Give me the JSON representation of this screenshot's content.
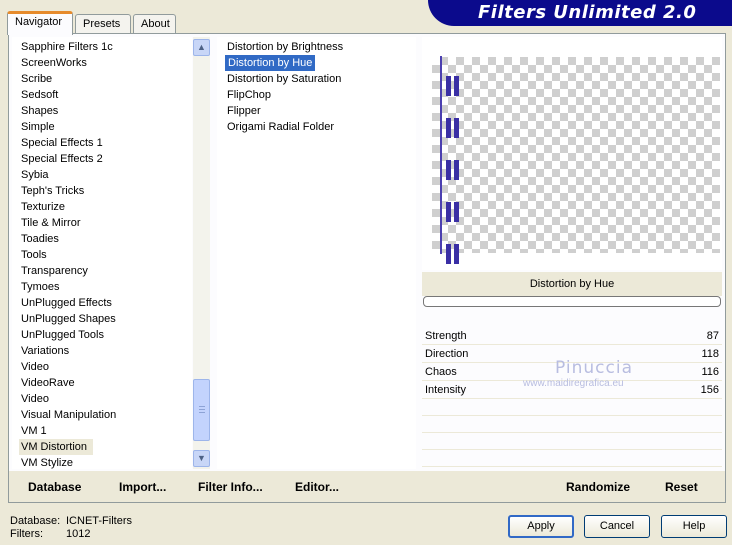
{
  "tabs": {
    "navigator": "Navigator",
    "presets": "Presets",
    "about": "About"
  },
  "banner_title": "Filters Unlimited 2.0",
  "categories": [
    "Sapphire Filters 1c",
    "ScreenWorks",
    "Scribe",
    "Sedsoft",
    "Shapes",
    "Simple",
    "Special Effects 1",
    "Special Effects 2",
    "Sybia",
    "Teph's Tricks",
    "Texturize",
    "Tile & Mirror",
    "Toadies",
    "Tools",
    "Transparency",
    "Tymoes",
    "UnPlugged Effects",
    "UnPlugged Shapes",
    "UnPlugged Tools",
    "Variations",
    "Video",
    "VideoRave",
    "Video",
    "Visual Manipulation",
    "VM 1",
    "VM Distortion",
    "VM Stylize"
  ],
  "selected_category": "VM Distortion",
  "filters": [
    "Distortion by Brightness",
    "Distortion by Hue",
    "Distortion by Saturation",
    "FlipChop",
    "Flipper",
    "Origami Radial Folder"
  ],
  "selected_filter": "Distortion by Hue",
  "filter_title": "Distortion by Hue",
  "params": [
    {
      "label": "Strength",
      "value": "87"
    },
    {
      "label": "Direction",
      "value": "118"
    },
    {
      "label": "Chaos",
      "value": "116"
    },
    {
      "label": "Intensity",
      "value": "156"
    }
  ],
  "watermark": {
    "name": "Pinuccia",
    "url": "www.maidiregrafica.eu"
  },
  "bottom_buttons": {
    "database": "Database",
    "import": "Import...",
    "filter_info": "Filter Info...",
    "editor": "Editor...",
    "randomize": "Randomize",
    "reset": "Reset"
  },
  "info": {
    "database_label": "Database:",
    "database_value": "ICNET-Filters",
    "filters_label": "Filters:",
    "filters_value": "1012"
  },
  "dialog_buttons": {
    "apply": "Apply",
    "cancel": "Cancel",
    "help": "Help"
  },
  "colors": {
    "selection": "#316ac5",
    "banner": "#0b0a8c",
    "stripe": "#3a2fa5"
  }
}
